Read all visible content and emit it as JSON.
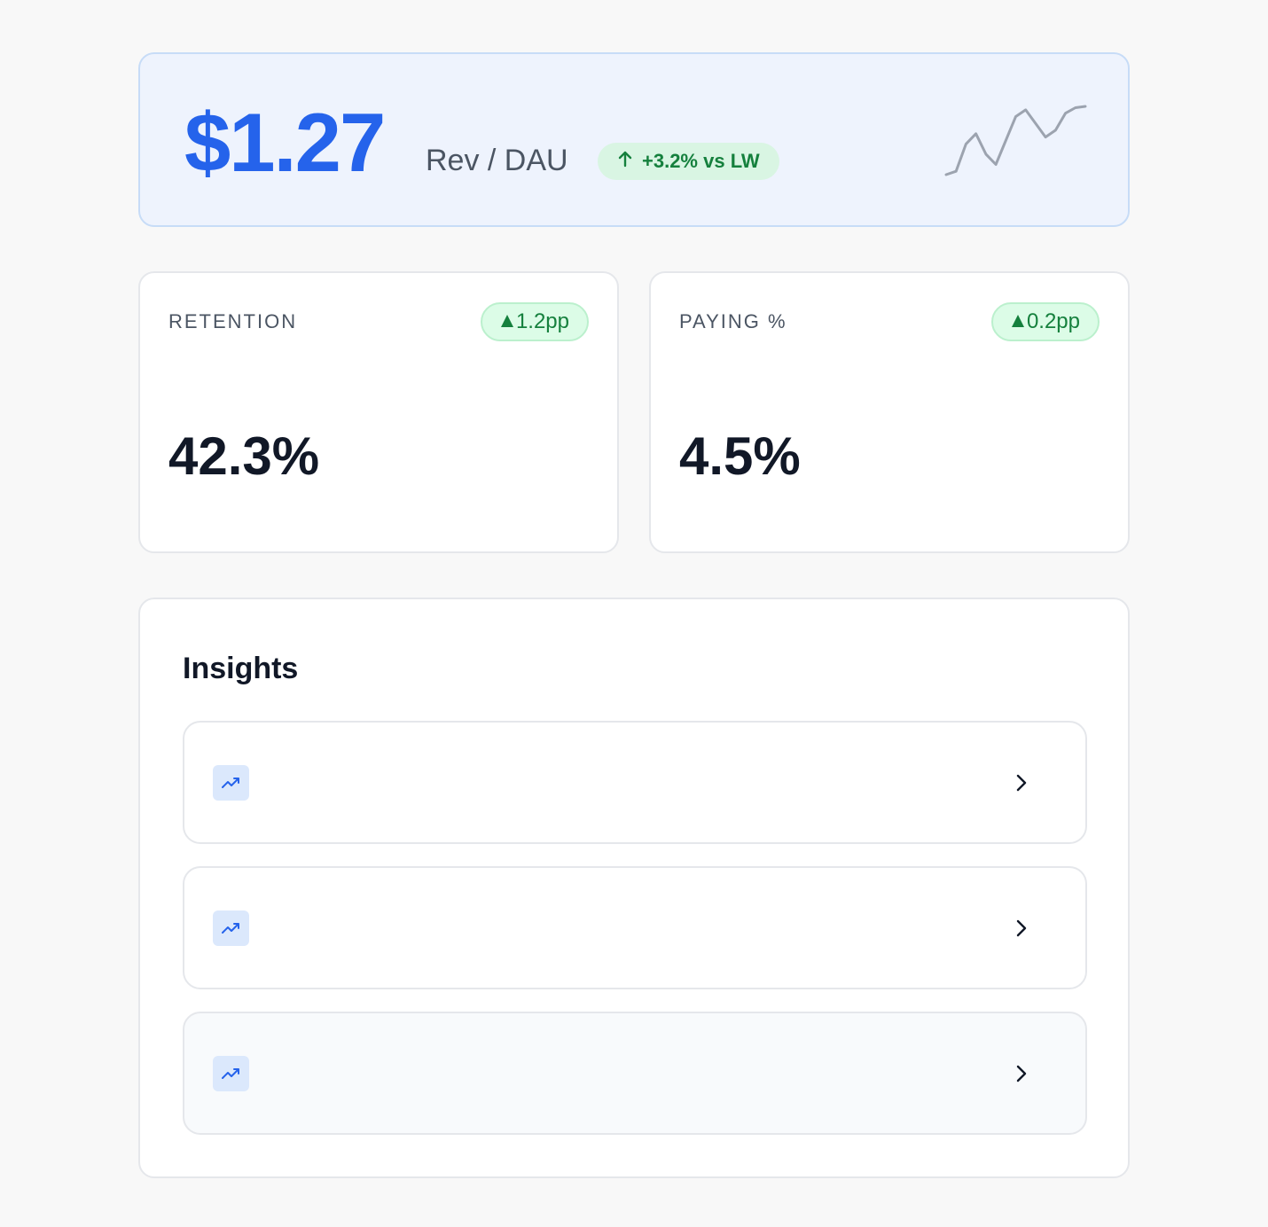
{
  "hero": {
    "value": "$1.27",
    "label": "Rev / DAU",
    "badge": "+3.2% vs LW",
    "trend_points": [
      0.0,
      0.05,
      0.45,
      0.6,
      0.3,
      0.15,
      0.5,
      0.85,
      0.95,
      0.75,
      0.55,
      0.65,
      0.9,
      0.98,
      1.0
    ]
  },
  "kpis": [
    {
      "label": "RETENTION",
      "badge": "1.2pp",
      "value": "42.3%"
    },
    {
      "label": "PAYING %",
      "badge": "0.2pp",
      "value": "4.5%"
    }
  ],
  "insights": {
    "title": "Insights",
    "items": [
      {
        "text": "",
        "icon": "trending-up-icon"
      },
      {
        "text": "",
        "icon": "trending-up-icon"
      },
      {
        "text": "",
        "icon": "trending-up-icon"
      }
    ]
  },
  "colors": {
    "accent": "#2563eb",
    "positive": "#15803d",
    "positive_bg": "#dcfce7",
    "hero_bg": "#eef3fd"
  }
}
